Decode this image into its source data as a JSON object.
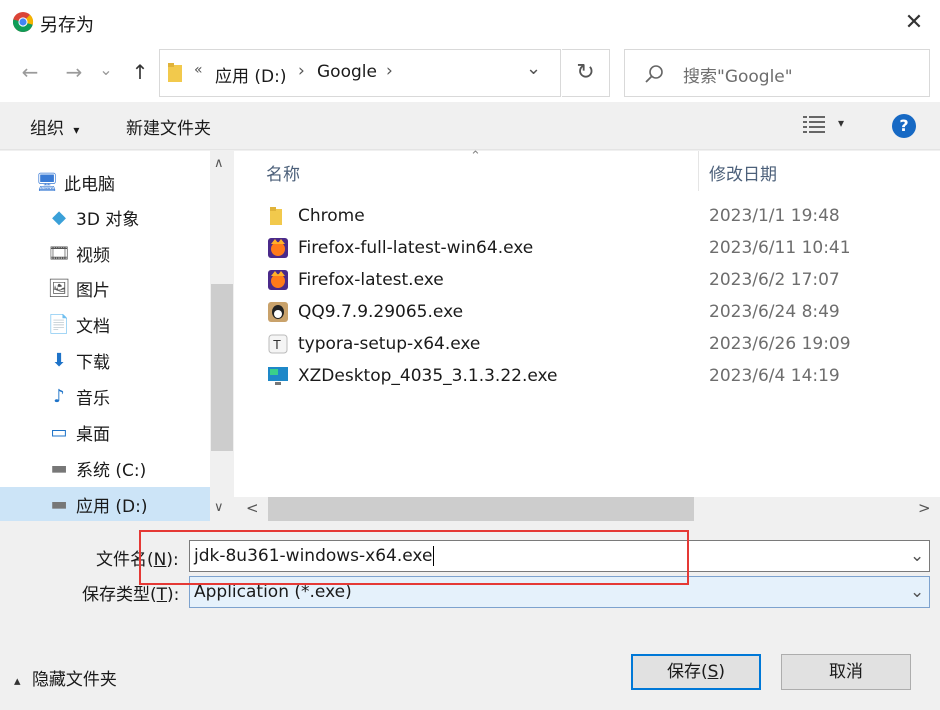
{
  "window": {
    "title": "另存为",
    "close_glyph": "✕"
  },
  "nav": {
    "back_glyph": "←",
    "forward_glyph": "→",
    "history_glyph": "⌄",
    "up_glyph": "↑",
    "breadcrumb_chevron": "«",
    "breadcrumb": [
      "应用 (D:)",
      "Google"
    ],
    "crumb_sep": "›",
    "dropdown_glyph": "⌄",
    "refresh_glyph": "↻",
    "search_placeholder": "搜索\"Google\""
  },
  "toolbar": {
    "organize_label": "组织",
    "organize_caret": "▾",
    "new_folder_label": "新建文件夹",
    "view_caret": "▾",
    "help_glyph": "?"
  },
  "sidebar": {
    "items": [
      {
        "label": "此电脑",
        "icon": "computer-icon",
        "glyph": "🖥"
      },
      {
        "label": "3D 对象",
        "icon": "cube-icon",
        "glyph": "◆"
      },
      {
        "label": "视频",
        "icon": "video-icon",
        "glyph": "🎞"
      },
      {
        "label": "图片",
        "icon": "picture-icon",
        "glyph": "🖼"
      },
      {
        "label": "文档",
        "icon": "document-icon",
        "glyph": "📄"
      },
      {
        "label": "下载",
        "icon": "download-icon",
        "glyph": "⬇"
      },
      {
        "label": "音乐",
        "icon": "music-icon",
        "glyph": "♪"
      },
      {
        "label": "桌面",
        "icon": "desktop-icon",
        "glyph": "▭"
      },
      {
        "label": "系统 (C:)",
        "icon": "drive-icon",
        "glyph": "▬"
      },
      {
        "label": "应用 (D:)",
        "icon": "drive-icon",
        "glyph": "▬",
        "selected": true
      }
    ],
    "scroll_up_glyph": "∧",
    "scroll_down_glyph": "∨"
  },
  "file_list": {
    "columns": {
      "name": "名称",
      "date": "修改日期"
    },
    "sort_glyph": "⌃",
    "rows": [
      {
        "name": "Chrome",
        "date": "2023/1/1 19:48",
        "icon": "folder-icon"
      },
      {
        "name": "Firefox-full-latest-win64.exe",
        "date": "2023/6/11 10:41",
        "icon": "firefox-icon"
      },
      {
        "name": "Firefox-latest.exe",
        "date": "2023/6/2 17:07",
        "icon": "firefox-icon"
      },
      {
        "name": "QQ9.7.9.29065.exe",
        "date": "2023/6/24 8:49",
        "icon": "qq-icon"
      },
      {
        "name": "typora-setup-x64.exe",
        "date": "2023/6/26 19:09",
        "icon": "typora-icon"
      },
      {
        "name": "XZDesktop_4035_3.1.3.22.exe",
        "date": "2023/6/4 14:19",
        "icon": "xzdesktop-icon"
      }
    ],
    "scroll_left_glyph": "<",
    "scroll_right_glyph": ">"
  },
  "form": {
    "filename_label": "文件名(",
    "filename_key": "N",
    "filename_label_end": "):",
    "filename_value": "jdk-8u361-windows-x64.exe",
    "filetype_label": "保存类型(",
    "filetype_key": "T",
    "filetype_label_end": "):",
    "filetype_value": "Application (*.exe)",
    "dropdown_glyph": "⌄"
  },
  "footer": {
    "hide_folders_caret": "▴",
    "hide_folders_label": "隐藏文件夹",
    "save_label": "保存(",
    "save_key": "S",
    "save_label_end": ")",
    "cancel_label": "取消"
  },
  "colors": {
    "selection": "#cce4f7",
    "accent": "#0078d7",
    "highlight_box": "#e53935"
  }
}
